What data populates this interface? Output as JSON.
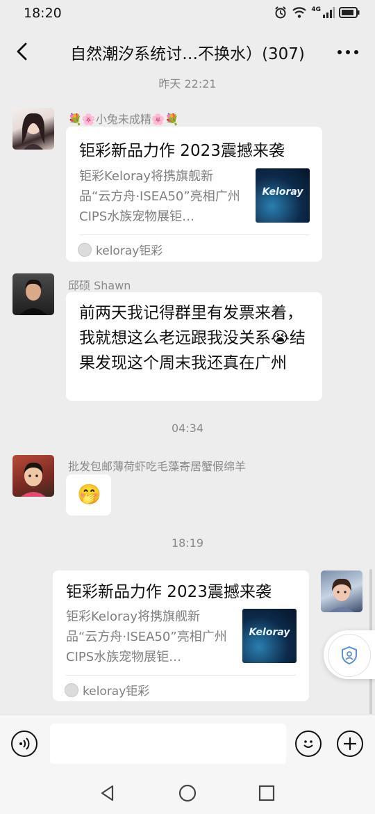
{
  "status_bar": {
    "time": "18:20",
    "network": "4G"
  },
  "nav": {
    "title": "自然潮汐系统讨…不换水）(307)"
  },
  "timestamps": {
    "t1": "昨天 22:21",
    "t2": "04:34",
    "t3": "18:19"
  },
  "messages": [
    {
      "sender": "💐🌸小兔未成精🌸💐",
      "card": {
        "title": "钜彩新品力作 2023震撼来袭",
        "desc": "钜彩Keloray将携旗舰新品“云方舟·ISEA50”亮相广州CIPS水族宠物展钜…",
        "thumb_text": "Keloray",
        "source": "keloray钜彩"
      }
    },
    {
      "sender": "邱硕 Shawn",
      "text": "前两天我记得群里有发票来着，我就想这么老远跟我没关系😭结果发现这个周末我还真在广州"
    },
    {
      "sender": "批发包邮薄荷虾吃毛藻寄居蟹假绵羊",
      "emoji": "🤭"
    },
    {
      "self": true,
      "card": {
        "title": "钜彩新品力作 2023震撼来袭",
        "desc": "钜彩Keloray将携旗舰新品“云方舟·ISEA50”亮相广州CIPS水族宠物展钜…",
        "thumb_text": "Keloray",
        "source": "keloray钜彩"
      }
    }
  ],
  "icons": [
    "back-icon",
    "more-icon",
    "voice-icon",
    "emoji-icon",
    "add-icon",
    "nav-back-icon",
    "nav-home-icon",
    "nav-recent-icon",
    "shield-icon"
  ]
}
